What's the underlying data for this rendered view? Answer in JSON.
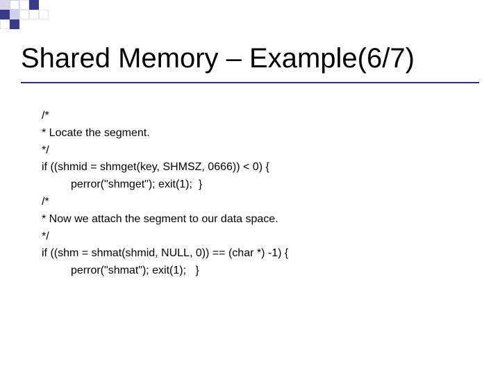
{
  "title": "Shared Memory – Example(6/7)",
  "code": {
    "l1": "/*",
    "l2": "* Locate the segment.",
    "l3": "*/",
    "l4": "if ((shmid = shmget(key, SHMSZ, 0666)) < 0) {",
    "l5": "perror(\"shmget\"); exit(1);  }",
    "l6": "/*",
    "l7": "* Now we attach the segment to our data space.",
    "l8": "*/",
    "l9": "if ((shm = shmat(shmid, NULL, 0)) == (char *) -1) {",
    "l10": "perror(\"shmat\"); exit(1);   }"
  }
}
